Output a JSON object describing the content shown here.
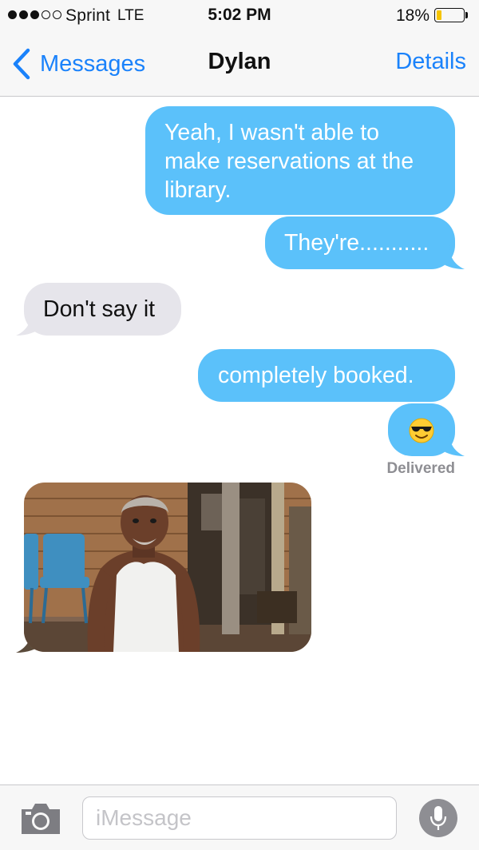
{
  "status_bar": {
    "signal_bars_filled": 3,
    "signal_bars_total": 5,
    "carrier": "Sprint",
    "network": "LTE",
    "time": "5:02 PM",
    "battery_percent_label": "18%",
    "battery_level": 0.18,
    "battery_color": "#f5c400"
  },
  "nav": {
    "back_label": "Messages",
    "title": "Dylan",
    "details_label": "Details",
    "accent_color": "#1a82fb"
  },
  "conversation": {
    "outgoing_color": "#5bc1fa",
    "incoming_color": "#e6e5eb",
    "messages": [
      {
        "direction": "outgoing",
        "text": "Yeah, I wasn't able to make reservations at the library."
      },
      {
        "direction": "outgoing",
        "text": "They're..........."
      },
      {
        "direction": "incoming",
        "text": "Don't say it"
      },
      {
        "direction": "outgoing",
        "text": "completely booked."
      },
      {
        "direction": "outgoing",
        "emoji": "smiling-face-with-sunglasses"
      },
      {
        "direction": "incoming",
        "image": "man-in-white-tank-top-on-porch-photo"
      }
    ],
    "delivery_status": "Delivered"
  },
  "input_bar": {
    "camera_icon": "camera-icon",
    "placeholder": "iMessage",
    "mic_icon": "microphone-icon"
  }
}
